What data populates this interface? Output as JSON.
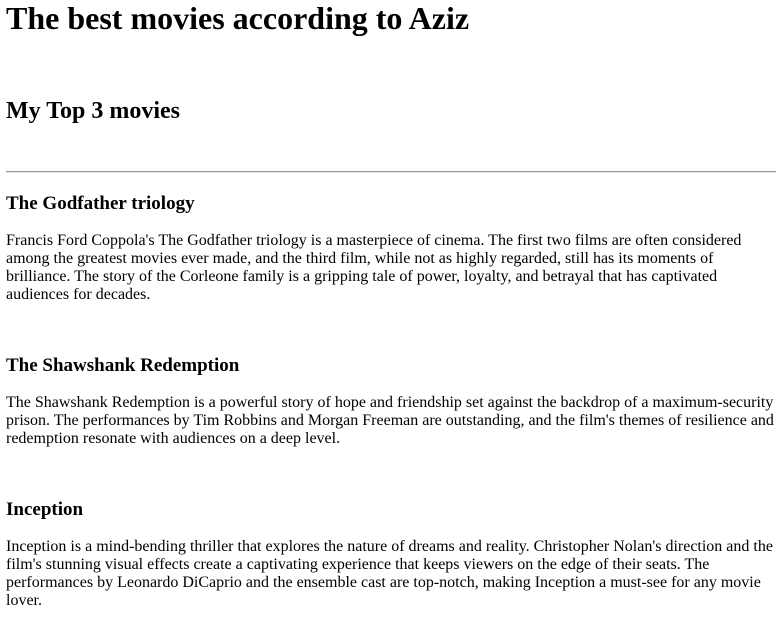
{
  "page": {
    "title": "The best movies according to Aziz",
    "subtitle": "My Top 3 movies"
  },
  "movies": [
    {
      "title": "The Godfather triology",
      "description": "Francis Ford Coppola's The Godfather triology is a masterpiece of cinema. The first two films are often considered among the greatest movies ever made, and the third film, while not as highly regarded, still has its moments of brilliance. The story of the Corleone family is a gripping tale of power, loyalty, and betrayal that has captivated audiences for decades."
    },
    {
      "title": "The Shawshank Redemption",
      "description": "The Shawshank Redemption is a powerful story of hope and friendship set against the backdrop of a maximum-security prison. The performances by Tim Robbins and Morgan Freeman are outstanding, and the film's themes of resilience and redemption resonate with audiences on a deep level."
    },
    {
      "title": "Inception",
      "description": "Inception is a mind-bending thriller that explores the nature of dreams and reality. Christopher Nolan's direction and the film's stunning visual effects create a captivating experience that keeps viewers on the edge of their seats. The performances by Leonardo DiCaprio and the ensemble cast are top-notch, making Inception a must-see for any movie lover."
    }
  ]
}
